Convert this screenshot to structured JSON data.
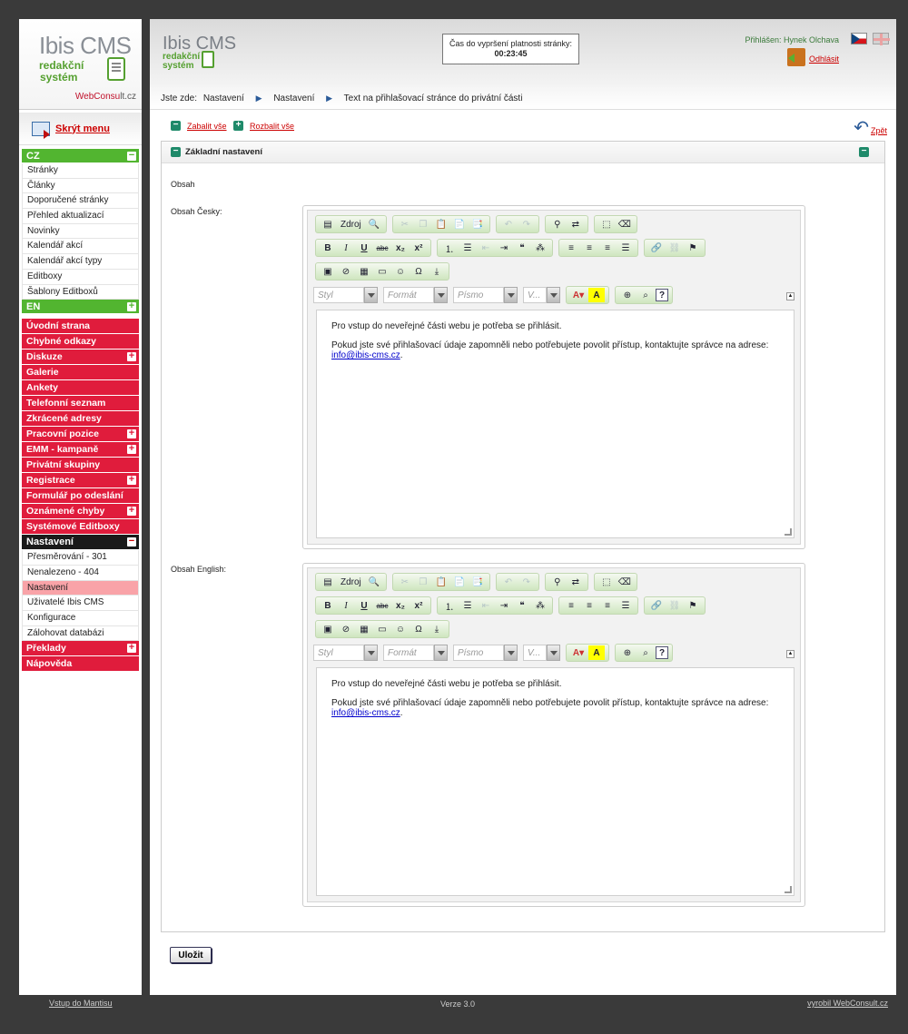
{
  "sidebar": {
    "logo_title": "Ibis CMS",
    "logo_sub1": "redakční",
    "logo_sub2": "systém",
    "webconsult_a": "WebConsu",
    "webconsult_b": "lt.cz",
    "hide_menu": "Skrýt menu",
    "cz_label": "CZ",
    "cz_items": [
      "Stránky",
      "Články",
      "Doporučené stránky",
      "Přehled aktualizací",
      "Novinky",
      "Kalendář akcí",
      "Kalendář akcí typy",
      "Editboxy",
      "Šablony Editboxů"
    ],
    "en_label": "EN",
    "red_items": [
      "Úvodní strana",
      "Chybné odkazy",
      "Diskuze",
      "Galerie",
      "Ankety",
      "Telefonní seznam",
      "Zkrácené adresy",
      "Pracovní pozice",
      "EMM - kampaně",
      "Privátní skupiny",
      "Registrace",
      "Formulář po odeslání",
      "Oznámené chyby",
      "Systémové Editboxy"
    ],
    "settings_label": "Nastavení",
    "settings_items": [
      "Přesměrování - 301",
      "Nenalezeno - 404",
      "Nastavení",
      "Uživatelé Ibis CMS",
      "Konfigurace",
      "Zálohovat databázi"
    ],
    "translations": "Překlady",
    "help": "Nápověda"
  },
  "header": {
    "logo_title": "Ibis CMS",
    "logo_sub1": "redakční",
    "logo_sub2": "systém",
    "timer_label": "Čas do vypršení platnosti stránky:",
    "timer_value": "00:23:45",
    "logged_in": "Přihlášen: Hynek Olchava",
    "logout": "Odhlásit"
  },
  "breadcrumb": {
    "prefix": "Jste zde:",
    "items": [
      "Nastavení",
      "Nastavení",
      "Text na přihlašovací stránce do privátní části"
    ]
  },
  "controls": {
    "collapse_all": "Zabalit vše",
    "expand_all": "Rozbalit vše",
    "back": "Zpět"
  },
  "panel": {
    "title": "Základní nastavení",
    "section_label": "Obsah",
    "field_cz": "Obsah Česky:",
    "field_en": "Obsah English:"
  },
  "editor": {
    "source_label": "Zdroj",
    "style_placeholder": "Styl",
    "format_placeholder": "Formát",
    "font_placeholder": "Písmo",
    "size_placeholder": "V...",
    "content_cz": {
      "p1": "Pro vstup do neveřejné části webu je potřeba se přihlásit.",
      "p2": "Pokud jste své přihlašovací údaje zapomněli nebo potřebujete povolit přístup, kontaktujte správce na adrese:",
      "email": "info@ibis-cms.cz"
    },
    "content_en": {
      "p1": "Pro vstup do neveřejné části webu je potřeba se přihlásit.",
      "p2": "Pokud jste své přihlašovací údaje zapomněli nebo potřebujete povolit přístup, kontaktujte správce na adrese:",
      "email": "info@ibis-cms.cz"
    }
  },
  "save_label": "Uložit",
  "footer": {
    "mantis": "Vstup do Mantisu",
    "version": "Verze 3.0",
    "made_by": "vyrobil WebConsult.cz"
  },
  "colors": {
    "menu_green": "#52b530",
    "menu_red": "#e01c3c",
    "menu_black": "#1a1a1a",
    "active_item": "#f9a3a8",
    "link_red": "#cc0000"
  }
}
